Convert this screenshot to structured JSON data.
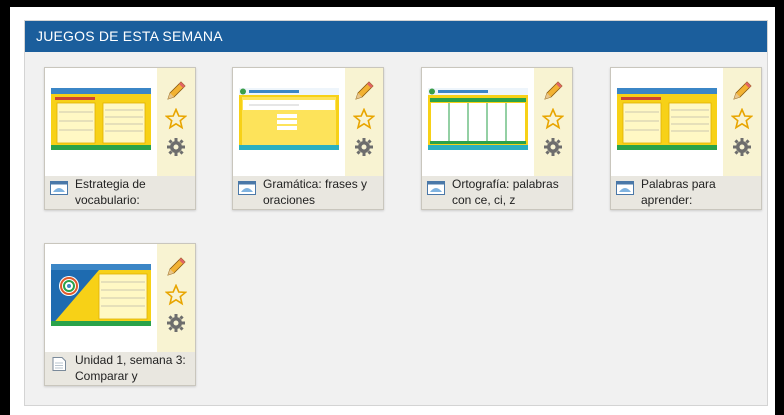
{
  "section": {
    "title": "JUEGOS DE ESTA SEMANA"
  },
  "colors": {
    "header": "#1b5e9c",
    "accent_yellow": "#f7d117",
    "action_bg": "#f8f3d2"
  },
  "cards": [
    {
      "title": "Estrategia de vocabulario:",
      "type_icon": "game-window-icon",
      "thumb": "yellow-form"
    },
    {
      "title": "Gramática: frases y oraciones",
      "type_icon": "game-window-icon",
      "thumb": "yellow-sentence"
    },
    {
      "title": "Ortografía: palabras con ce, ci, z",
      "type_icon": "game-window-icon",
      "thumb": "green-columns"
    },
    {
      "title": "Palabras para aprender:",
      "type_icon": "game-window-icon",
      "thumb": "yellow-form"
    },
    {
      "title": "Unidad 1, semana 3: Comparar y",
      "type_icon": "document-icon",
      "thumb": "diagram"
    }
  ],
  "actions": {
    "edit": "pencil-icon",
    "favorite": "star-icon",
    "settings": "gear-icon"
  }
}
